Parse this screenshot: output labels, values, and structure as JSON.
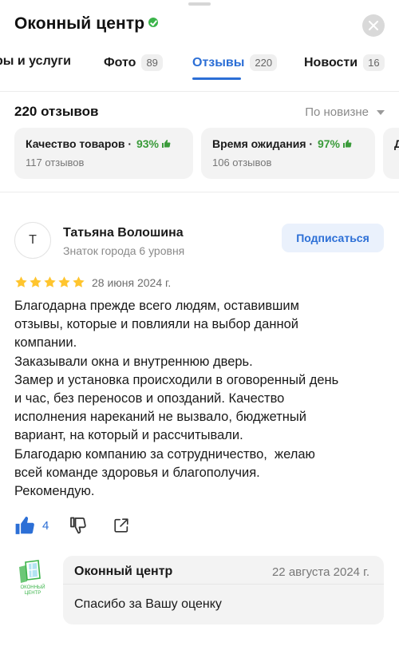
{
  "header": {
    "title": "Оконный центр"
  },
  "tabs": [
    {
      "label": "ры и услуги",
      "count": ""
    },
    {
      "label": "Фото",
      "count": "89"
    },
    {
      "label": "Отзывы",
      "count": "220"
    },
    {
      "label": "Новости",
      "count": "16"
    }
  ],
  "summary": {
    "total_label": "220 отзывов",
    "sort_label": "По новизне"
  },
  "chips": [
    {
      "title": "Качество товаров",
      "percent": "93%",
      "sub": "117 отзывов"
    },
    {
      "title": "Время ожидания",
      "percent": "97%",
      "sub": "106 отзывов"
    },
    {
      "title": "Д",
      "percent": "",
      "sub": ""
    }
  ],
  "review": {
    "avatar_letter": "Т",
    "author": "Татьяна Волошина",
    "level": "Знаток города 6 уровня",
    "subscribe_label": "Подписаться",
    "rating": 5,
    "date": "28 июня 2024 г.",
    "lines": [
      "Благодарна прежде всего людям, оставившим",
      "отзывы, которые и повлияли на выбор данной",
      "компании.",
      "Заказывали окна и внутреннюю дверь.",
      "Замер и установка происходили в оговоренный день",
      "и час, без переносов и опозданий. Качество",
      "исполнения нареканий не вызвало, бюджетный",
      "вариант, на который и рассчитывали.",
      "Благодарю компанию за сотрудничество,  желаю",
      "всей команде здоровья и благополучия.",
      "Рекомендую."
    ],
    "likes": "4"
  },
  "reply": {
    "logo_lines": [
      "ОКОННЫЙ",
      "ЦЕНТР"
    ],
    "org": "Оконный центр",
    "date": "22 августа 2024 г.",
    "text": "Спасибо за Вашу оценку"
  },
  "colors": {
    "accent": "#2c6fd6",
    "positive": "#3a9b3a",
    "star": "#ffc52e",
    "verified": "#3bb44a"
  }
}
